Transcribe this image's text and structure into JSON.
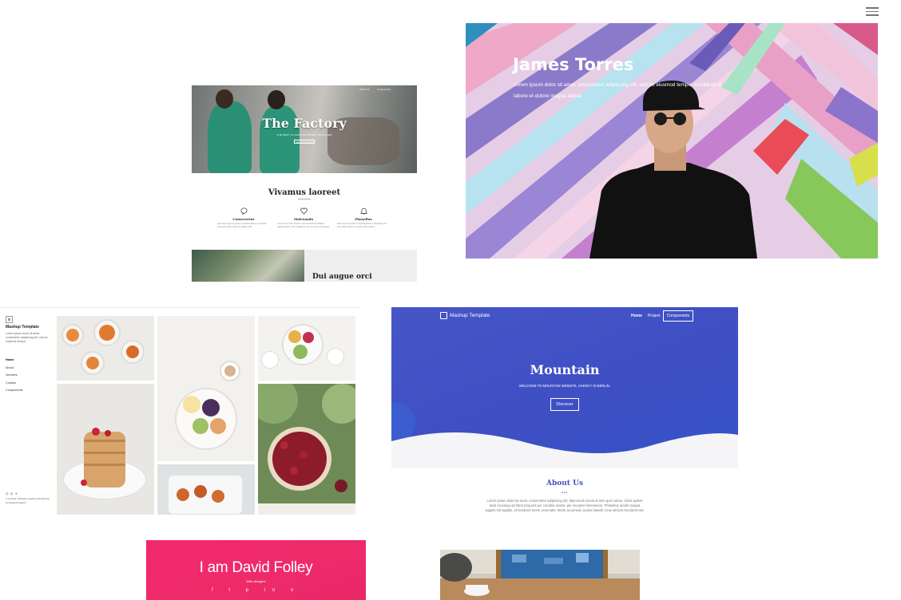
{
  "header": {
    "menu_icon": "hamburger-menu-icon"
  },
  "factory": {
    "title": "The Factory",
    "subtitle": "THE BEST PLACE FOR WORK TOGETHER",
    "cta": "GET IN TOUCH",
    "nav": [
      "About Us",
      "Components"
    ],
    "section_title": "Vivamus laoreet",
    "features": [
      {
        "icon": "chat-bubble-icon",
        "name": "Consectetur",
        "text": "Quis quam nam in ipsum in reprehenderit in voluptate velit esse cillum dolore eu fugiat nulla."
      },
      {
        "icon": "heart-icon",
        "name": "Malesuada",
        "text": "Ut enim ad minim veniam, quis nostrud exercitation ullamco laboris nisi ut aliquip ex ea commodo consequat."
      },
      {
        "icon": "bell-icon",
        "name": "Phasellus",
        "text": "Duis aute irure dolor in reprehenderit in voluptate velit esse cillum dolore eu fugiat nulla pariatur."
      }
    ],
    "bottom_title": "Dui augue orci"
  },
  "james": {
    "name": "James Torres",
    "text": "Lorem ipsum dolor sit amet, consectetur adipiscing elit, sed do eiusmod tempor incididunt ut labore et dolore magna aliqua."
  },
  "food": {
    "brand": "Mashup Template",
    "desc": "Lorem ipsum dolor sit amet, consectetur adipiscing elit, sed do eiusmod tempor.",
    "nav": [
      "Home",
      "About",
      "Services",
      "Contact",
      "Components"
    ],
    "social": [
      "◎",
      "◎",
      "✦"
    ],
    "footer": "© Untitled | Website created with Mashup Template/Unsplash"
  },
  "mountain": {
    "brand": "Mashup Template",
    "nav": [
      "Home",
      "Project"
    ],
    "components_label": "Components",
    "title": "Mountain",
    "subtitle": "WELCOME TO MOUNTAIN WEBSITE, AGENCY IN BERLIN.",
    "button": "Discover",
    "about_title": "About Us",
    "about_dots": "•••",
    "about_text": "Lorem ipsum dolor sit amet, consectetur adipiscing elit. Maecenas luctus at sem quis varius. Class aptent taciti sociosqu ad litora torquent per conubia nostra, per inceptos himenaeos. Phasellus iaculis magna sagittis elit sagittis, at hendrerit lorem venenatis. Morbi accumsan iaculis blandit. Cras ultrices hendrerit nisl."
  },
  "david": {
    "name": "I am David Folley",
    "role": "Web designer",
    "social": [
      "f",
      "t",
      "p",
      "in",
      "v"
    ]
  }
}
